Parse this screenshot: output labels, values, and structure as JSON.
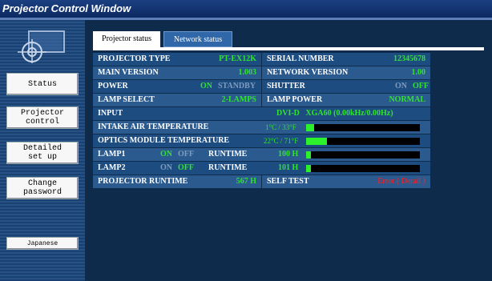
{
  "window": {
    "title": "Projector Control Window"
  },
  "sidebar": {
    "items": [
      {
        "label": "Status"
      },
      {
        "label": "Projector\ncontrol"
      },
      {
        "label": "Detailed\nset up"
      },
      {
        "label": "Change\npassword"
      }
    ],
    "language_button": "Japanese"
  },
  "tabs": [
    {
      "label": "Projector status",
      "active": true
    },
    {
      "label": "Network status",
      "active": false
    }
  ],
  "status": {
    "projector_type": {
      "label": "PROJECTOR TYPE",
      "value": "PT-EX12K"
    },
    "serial_number": {
      "label": "SERIAL NUMBER",
      "value": "12345678"
    },
    "main_version": {
      "label": "MAIN VERSION",
      "value": "1.003"
    },
    "network_version": {
      "label": "NETWORK VERSION",
      "value": "1.00"
    },
    "power": {
      "label": "POWER",
      "on": "ON",
      "standby": "STANDBY",
      "state": "ON"
    },
    "shutter": {
      "label": "SHUTTER",
      "on": "ON",
      "off": "OFF",
      "state": "OFF"
    },
    "lamp_select": {
      "label": "LAMP SELECT",
      "value": "2-LAMPS"
    },
    "lamp_power": {
      "label": "LAMP POWER",
      "value": "NORMAL"
    },
    "input": {
      "label": "INPUT",
      "value": "DVI-D   XGA60 (0.00kHz/0.00Hz)"
    },
    "intake_temp": {
      "label": "INTAKE AIR TEMPERATURE",
      "value": "1°C / 33°F",
      "level": 0.07
    },
    "optics_temp": {
      "label": "OPTICS MODULE TEMPERATURE",
      "value": "22°C / 71°F",
      "level": 0.18
    },
    "lamp1": {
      "label": "LAMP1",
      "on": "ON",
      "off": "OFF",
      "state": "ON",
      "runtime_label": "RUNTIME",
      "runtime": "100 H",
      "level": 0.04
    },
    "lamp2": {
      "label": "LAMP2",
      "on": "ON",
      "off": "OFF",
      "state": "OFF",
      "runtime_label": "RUNTIME",
      "runtime": "101 H",
      "level": 0.04
    },
    "projector_runtime": {
      "label": "PROJECTOR RUNTIME",
      "value": "567 H"
    },
    "self_test": {
      "label": "SELF TEST",
      "value": "Error ( Detail )"
    }
  },
  "colors": {
    "on_green": "#32e232",
    "off_gray": "#7f9cbf",
    "error_red": "#ff2020",
    "bar_fill": "#2cf02c"
  }
}
